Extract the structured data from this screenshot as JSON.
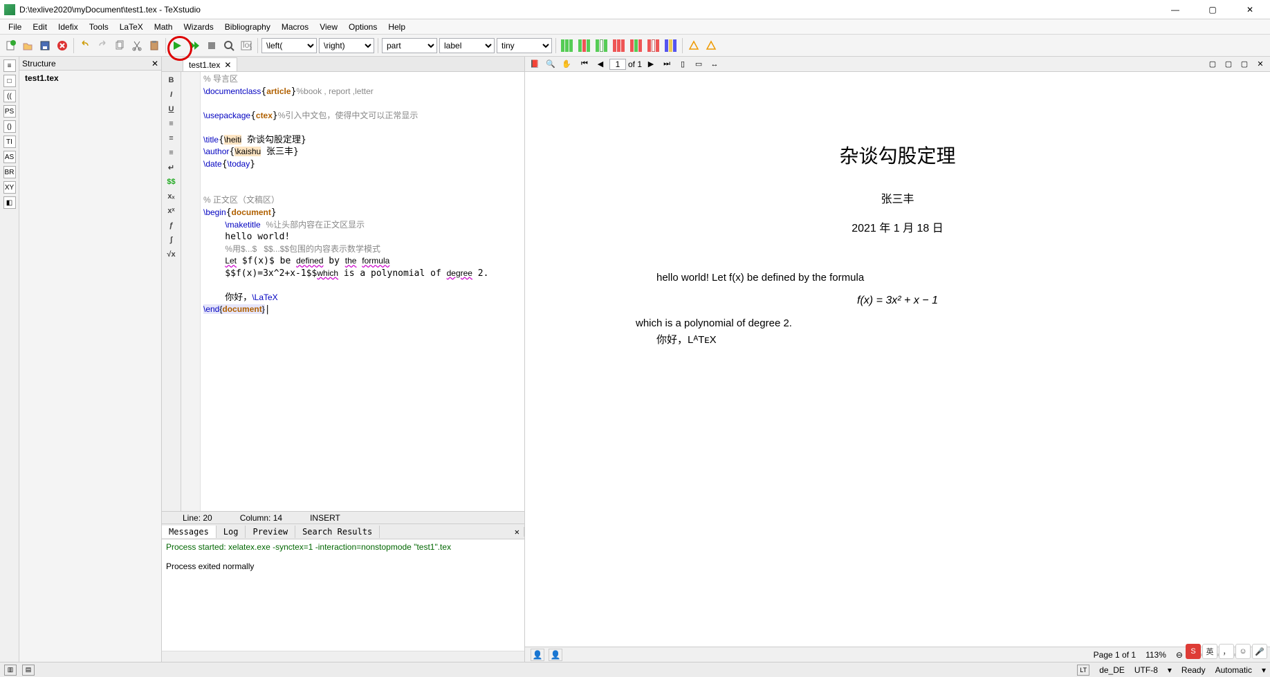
{
  "window": {
    "title": "D:\\texlive2020\\myDocument\\test1.tex - TeXstudio"
  },
  "menu": [
    "File",
    "Edit",
    "Idefix",
    "Tools",
    "LaTeX",
    "Math",
    "Wizards",
    "Bibliography",
    "Macros",
    "View",
    "Options",
    "Help"
  ],
  "toolbar": {
    "combo_left": "\\left(",
    "combo_right": "\\right)",
    "combo_sect": "part",
    "combo_ref": "label",
    "combo_size": "tiny"
  },
  "structure": {
    "title": "Structure",
    "node": "test1.tex"
  },
  "left_icons": [
    "≡",
    "□",
    "((",
    "PS",
    "()",
    "TI",
    "AS",
    "BR",
    "XY",
    "◧"
  ],
  "editor": {
    "tab": "test1.tex",
    "side_icons": [
      "B",
      "I",
      "U",
      "≡",
      "≡",
      "≡",
      "↵",
      "$$",
      "xₓ",
      "xˣ",
      "ƒ",
      "∫",
      "√x"
    ],
    "status": {
      "line": "Line: 20",
      "col": "Column: 14",
      "mode": "INSERT"
    }
  },
  "messages": {
    "tabs": [
      "Messages",
      "Log",
      "Preview",
      "Search Results"
    ],
    "line1": "Process started: xelatex.exe -synctex=1 -interaction=nonstopmode \"test1\".tex",
    "line2": "Process exited normally"
  },
  "preview_tb": {
    "page_input": "1",
    "page_of": "of 1"
  },
  "doc": {
    "title": "杂谈勾股定理",
    "author": "张三丰",
    "date": "2021 年 1 月 18 日",
    "p1": "hello world! Let f(x) be defined by the formula",
    "eq": "f(x) = 3x² + x − 1",
    "p2": "which is a polynomial of degree 2.",
    "p3": "你好，LᴬTᴇX"
  },
  "preview_ft": {
    "pages": "Page 1 of 1",
    "zoom": "113%"
  },
  "statusbar": {
    "lang": "de_DE",
    "enc": "UTF-8",
    "ready": "Ready",
    "auto": "Automatic"
  },
  "ime": {
    "method": "S",
    "lang": "英",
    "punct": "，",
    "emoji": "☺",
    "voice": "🎤"
  }
}
